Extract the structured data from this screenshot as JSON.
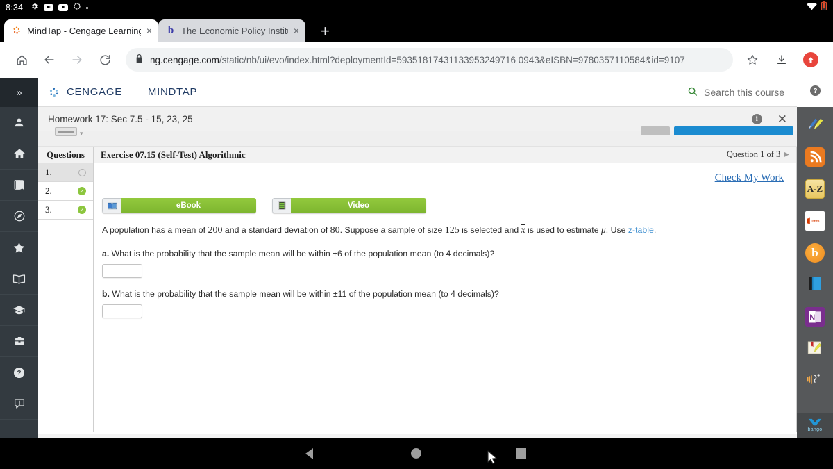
{
  "statusbar": {
    "clock": "8:34",
    "icons": [
      "gear-icon",
      "youtube-icon",
      "youtube-icon",
      "spinner-icon",
      "dot-icon"
    ],
    "right_icons": [
      "wifi-icon",
      "battery-icon"
    ]
  },
  "browser": {
    "tabs": [
      {
        "title": "MindTap - Cengage Learning",
        "favicon": "cengage-icon",
        "active": true,
        "close": "×"
      },
      {
        "title": "The Economic Policy Institut",
        "favicon": "b-icon",
        "active": false,
        "close": "×"
      }
    ],
    "new_tab_label": "+",
    "nav": {
      "home": "⌂",
      "back": "←",
      "forward": "→",
      "reload": "⟳"
    },
    "omnibox": {
      "lock": "🔒",
      "url_host": "ng.cengage.com",
      "url_path": "/static/nb/ui/evo/index.html?deploymentId=59351817431133953249716 0943&eISBN=9780357110584&id=9107"
    },
    "actions": {
      "bookmark": "☆",
      "download": "⬇",
      "profile": "⬆"
    }
  },
  "left_rail": {
    "expand_label": "»",
    "items": [
      {
        "name": "sidebar-item-profile",
        "icon": "person-icon"
      },
      {
        "name": "sidebar-item-home",
        "icon": "home-icon"
      },
      {
        "name": "sidebar-item-ebook",
        "icon": "book-icon"
      },
      {
        "name": "sidebar-item-explore",
        "icon": "compass-icon"
      },
      {
        "name": "sidebar-item-favorites",
        "icon": "star-icon"
      },
      {
        "name": "sidebar-item-reader",
        "icon": "open-book-icon"
      },
      {
        "name": "sidebar-item-grades",
        "icon": "graduation-cap-icon"
      },
      {
        "name": "sidebar-item-career",
        "icon": "briefcase-icon"
      },
      {
        "name": "sidebar-item-help",
        "icon": "question-circle-icon"
      },
      {
        "name": "sidebar-item-feedback",
        "icon": "feedback-icon"
      }
    ]
  },
  "right_rail": {
    "help_icon": "question-circle-icon",
    "items": [
      {
        "name": "rail-tool-highlighter",
        "icon": "pen-highlighter-icon"
      },
      {
        "name": "rail-tool-rss",
        "icon": "rss-icon",
        "color": "#eb7a20"
      },
      {
        "name": "rail-tool-dictionary",
        "icon": "a-z-icon",
        "label": "A-Z"
      },
      {
        "name": "rail-tool-office",
        "icon": "ms-office-icon",
        "label": "Office"
      },
      {
        "name": "rail-tool-bing",
        "icon": "bing-icon",
        "label": "b"
      },
      {
        "name": "rail-tool-ebook",
        "icon": "blue-book-icon"
      },
      {
        "name": "rail-tool-onenote",
        "icon": "onenote-icon",
        "label": "N"
      },
      {
        "name": "rail-tool-bookmark",
        "icon": "bookmark-highlighter-icon"
      },
      {
        "name": "rail-tool-read-aloud",
        "icon": "read-aloud-icon"
      }
    ],
    "bango": {
      "chevron": "⌵",
      "label": "bango"
    }
  },
  "mindtap": {
    "brand_cengage": "CENGAGE",
    "brand_mindtap": "MINDTAP",
    "search": {
      "icon": "search-icon",
      "label": "Search this course"
    },
    "homework": {
      "title": "Homework 17: Sec 7.5 - 15, 23, 25",
      "info_icon": "info-icon",
      "close_icon": "close-icon",
      "info_label": "i",
      "close_label": "✕"
    }
  },
  "exercise": {
    "questions_header": "Questions",
    "questions": [
      {
        "label": "1.",
        "status": "unanswered",
        "selected": true
      },
      {
        "label": "2.",
        "status": "correct",
        "selected": false
      },
      {
        "label": "3.",
        "status": "correct",
        "selected": false
      }
    ],
    "title": "Exercise 07.15 (Self-Test) Algorithmic",
    "question_counter": "Question 1 of 3",
    "next_arrow": "▶",
    "check_my_work": "Check My Work",
    "media_buttons": [
      {
        "label": "eBook",
        "icon": "book-icon"
      },
      {
        "label": "Video",
        "icon": "film-icon"
      }
    ],
    "prompt": {
      "part1": "A population has a mean of ",
      "mean": "200",
      "part2": " and a standard deviation of ",
      "sd": "80",
      "part3": ". Suppose a sample of size ",
      "n": "125",
      "part4": " is selected and ",
      "xbar": "x",
      "part5": " is used to estimate ",
      "mu": "μ",
      "part6": ". Use ",
      "ztable_link": "z-table",
      "part7": "."
    },
    "parts": [
      {
        "letter": "a.",
        "text_before": " What is the probability that the sample mean will be within ",
        "value": "±6",
        "text_after": " of the population mean (to 4 decimals)?",
        "answer": "",
        "placeholder": ""
      },
      {
        "letter": "b.",
        "text_before": " What is the probability that the sample mean will be within ",
        "value": "±11",
        "text_after": " of the population mean (to 4 decimals)?",
        "answer": "",
        "placeholder": ""
      }
    ]
  },
  "android_nav": {
    "back": "back-button",
    "home": "home-button",
    "recents": "recents-button"
  },
  "colors": {
    "rail_dark": "#333a40",
    "rail_right": "#56585a",
    "green_button": "#8cc63e",
    "link_blue": "#2a6db5",
    "cengage_navy": "#1f3a63"
  }
}
